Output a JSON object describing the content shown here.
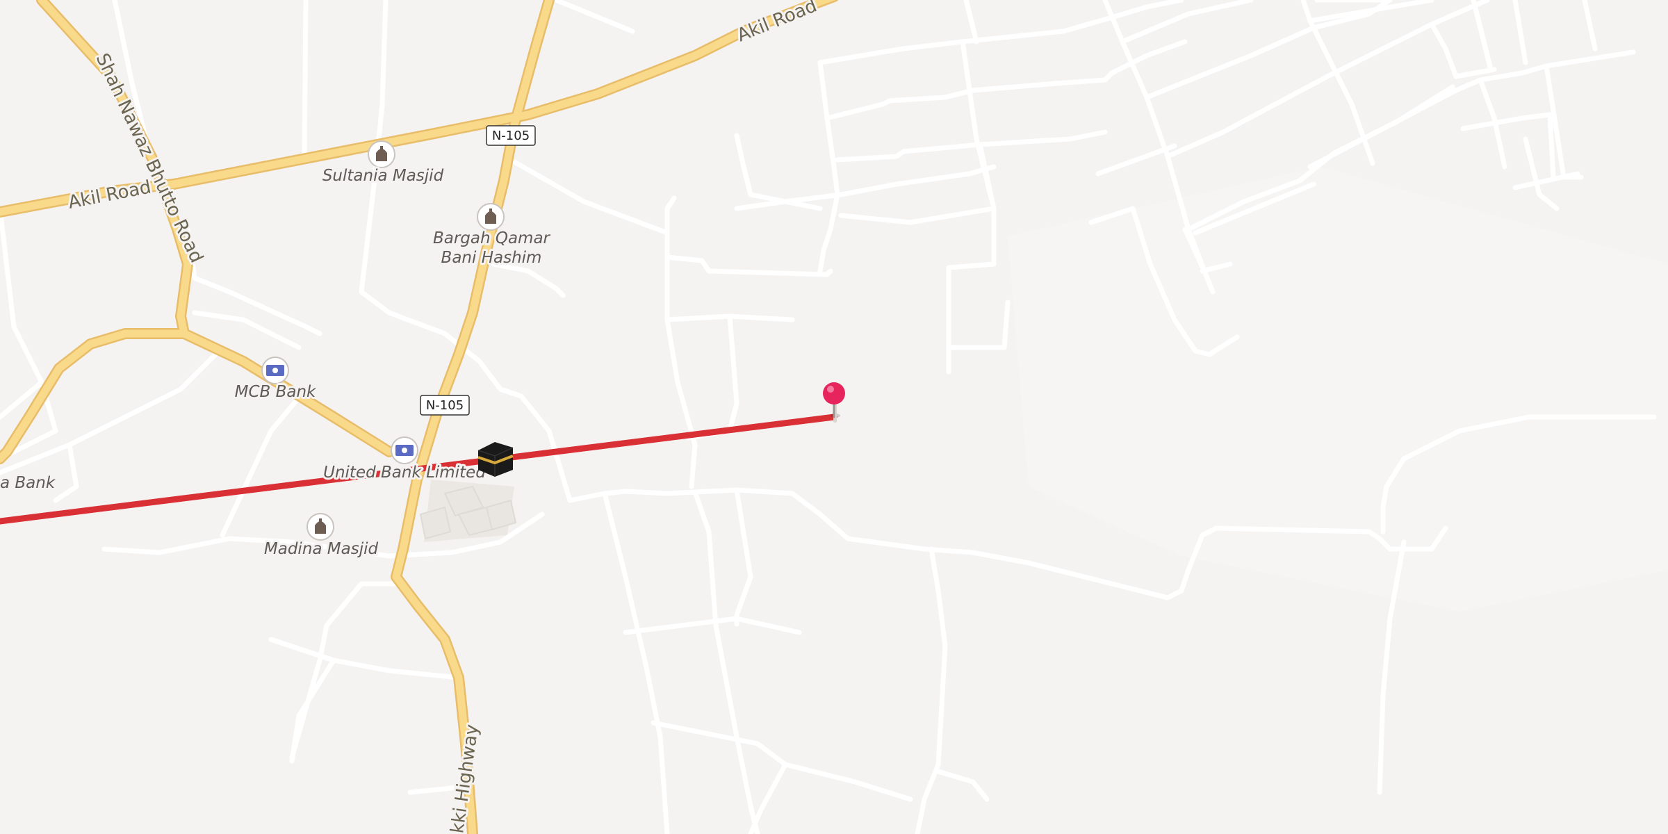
{
  "map": {
    "roads": {
      "akil_road_east": "Akil Road",
      "akil_road_west": "Akil Road",
      "shah_nawaz_bhutto_road": "Shah Nawaz Bhutto Road",
      "highway_south": "kki Highway"
    },
    "shields": {
      "n105_north": "N-105",
      "n105_south": "N-105"
    },
    "pois": {
      "sultania_masjid": "Sultania Masjid",
      "bargah_line1": "Bargah Qamar",
      "bargah_line2": "Bani Hashim",
      "mcb_bank": "MCB Bank",
      "ubl": "United Bank Limited",
      "madina_masjid": "Madina Masjid",
      "partial_bank": "a Bank"
    },
    "icons": {
      "mosque": "mosque-icon",
      "bank": "bank-icon",
      "kaaba": "kaaba-icon",
      "pin": "location-pin-icon"
    },
    "colors": {
      "background": "#f5f3f1",
      "minor_road": "#ffffff",
      "major_road": "#f9d98a",
      "major_road_casing": "#e8bd6a",
      "route_line": "#d93035",
      "pin_head": "#e8245d"
    }
  }
}
